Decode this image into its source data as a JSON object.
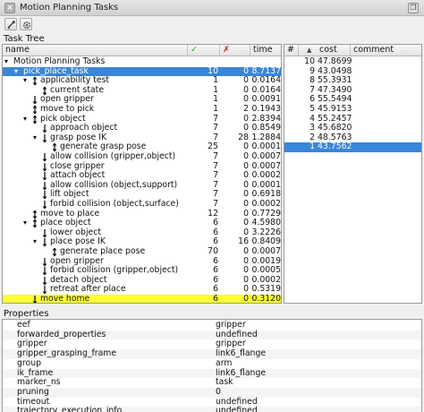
{
  "window": {
    "title": "Motion Planning Tasks",
    "close_glyph": "×",
    "float_glyph": "❐"
  },
  "toolbar": {
    "buttons": [
      "reset-icon",
      "settings-icon"
    ]
  },
  "task_tree": {
    "label": "Task Tree",
    "columns": {
      "name": "name",
      "ok": "✓",
      "fail": "✗",
      "time": "time"
    },
    "ok_color": "#2e9e2e",
    "fail_color": "#d42020",
    "rows": [
      {
        "name": "Motion Planning Tasks",
        "ok": "",
        "fail": "",
        "time": "",
        "icon": "",
        "expander": "▾",
        "level": 0
      },
      {
        "name": "pick_place_task",
        "ok": "10",
        "fail": "0",
        "time": "8.7137",
        "icon": "",
        "expander": "▾",
        "level": 1,
        "selected": true
      },
      {
        "name": "applicability test",
        "ok": "1",
        "fail": "0",
        "time": "0.0164",
        "icon": "both",
        "expander": "▾",
        "level": 2
      },
      {
        "name": "current state",
        "ok": "1",
        "fail": "0",
        "time": "0.0164",
        "icon": "both",
        "expander": "",
        "level": 3
      },
      {
        "name": "open gripper",
        "ok": "1",
        "fail": "0",
        "time": "0.0091",
        "icon": "down",
        "expander": "",
        "level": 2
      },
      {
        "name": "move to pick",
        "ok": "1",
        "fail": "2",
        "time": "0.1943",
        "icon": "both",
        "expander": "",
        "level": 2
      },
      {
        "name": "pick object",
        "ok": "7",
        "fail": "0",
        "time": "2.8394",
        "icon": "both",
        "expander": "▾",
        "level": 2
      },
      {
        "name": "approach object",
        "ok": "7",
        "fail": "0",
        "time": "0.8549",
        "icon": "down",
        "expander": "",
        "level": 3
      },
      {
        "name": "grasp pose IK",
        "ok": "7",
        "fail": "28",
        "time": "1.2884",
        "icon": "down",
        "expander": "▾",
        "level": 3
      },
      {
        "name": "generate grasp pose",
        "ok": "25",
        "fail": "0",
        "time": "0.0001",
        "icon": "both",
        "expander": "",
        "level": 4
      },
      {
        "name": "allow collision (gripper,object)",
        "ok": "7",
        "fail": "0",
        "time": "0.0007",
        "icon": "down",
        "expander": "",
        "level": 3
      },
      {
        "name": "close gripper",
        "ok": "7",
        "fail": "0",
        "time": "0.0007",
        "icon": "down",
        "expander": "",
        "level": 3
      },
      {
        "name": "attach object",
        "ok": "7",
        "fail": "0",
        "time": "0.0002",
        "icon": "down",
        "expander": "",
        "level": 3
      },
      {
        "name": "allow collision (object,support)",
        "ok": "7",
        "fail": "0",
        "time": "0.0001",
        "icon": "down",
        "expander": "",
        "level": 3
      },
      {
        "name": "lift object",
        "ok": "7",
        "fail": "0",
        "time": "0.6918",
        "icon": "down",
        "expander": "",
        "level": 3
      },
      {
        "name": "forbid collision (object,surface)",
        "ok": "7",
        "fail": "0",
        "time": "0.0002",
        "icon": "down",
        "expander": "",
        "level": 3
      },
      {
        "name": "move to place",
        "ok": "12",
        "fail": "0",
        "time": "0.7729",
        "icon": "both",
        "expander": "",
        "level": 2
      },
      {
        "name": "place object",
        "ok": "6",
        "fail": "0",
        "time": "4.5980",
        "icon": "both",
        "expander": "▾",
        "level": 2
      },
      {
        "name": "lower object",
        "ok": "6",
        "fail": "0",
        "time": "3.2226",
        "icon": "down",
        "expander": "",
        "level": 3
      },
      {
        "name": "place pose IK",
        "ok": "6",
        "fail": "16",
        "time": "0.8409",
        "icon": "down",
        "expander": "▾",
        "level": 3
      },
      {
        "name": "generate place pose",
        "ok": "70",
        "fail": "0",
        "time": "0.0007",
        "icon": "both",
        "expander": "",
        "level": 4
      },
      {
        "name": "open gripper",
        "ok": "6",
        "fail": "0",
        "time": "0.0019",
        "icon": "down",
        "expander": "",
        "level": 3
      },
      {
        "name": "forbid collision (gripper,object)",
        "ok": "6",
        "fail": "0",
        "time": "0.0005",
        "icon": "down",
        "expander": "",
        "level": 3
      },
      {
        "name": "detach object",
        "ok": "6",
        "fail": "0",
        "time": "0.0002",
        "icon": "down",
        "expander": "",
        "level": 3
      },
      {
        "name": "retreat after place",
        "ok": "6",
        "fail": "0",
        "time": "0.5319",
        "icon": "down",
        "expander": "",
        "level": 3
      },
      {
        "name": "move home",
        "ok": "6",
        "fail": "0",
        "time": "0.3120",
        "icon": "down",
        "expander": "",
        "level": 2,
        "highlight": true
      }
    ]
  },
  "solutions": {
    "columns": {
      "index": "#",
      "sort": "▲",
      "cost": "cost",
      "comment": "comment"
    },
    "rows": [
      {
        "index": "10",
        "cost": "47.8699"
      },
      {
        "index": "9",
        "cost": "43.0498"
      },
      {
        "index": "8",
        "cost": "55.3931"
      },
      {
        "index": "7",
        "cost": "47.3490"
      },
      {
        "index": "6",
        "cost": "55.5494"
      },
      {
        "index": "5",
        "cost": "45.9153"
      },
      {
        "index": "4",
        "cost": "55.2457"
      },
      {
        "index": "3",
        "cost": "45.6820"
      },
      {
        "index": "2",
        "cost": "48.5763"
      },
      {
        "index": "1",
        "cost": "43.7562",
        "selected": true
      }
    ]
  },
  "properties": {
    "label": "Properties",
    "rows": [
      {
        "key": "eef",
        "value": "gripper"
      },
      {
        "key": "forwarded_properties",
        "value": "undefined"
      },
      {
        "key": "gripper",
        "value": "gripper"
      },
      {
        "key": "gripper_grasping_frame",
        "value": "link6_flange"
      },
      {
        "key": "group",
        "value": "arm"
      },
      {
        "key": "ik_frame",
        "value": "link6_flange"
      },
      {
        "key": "marker_ns",
        "value": "task"
      },
      {
        "key": "pruning",
        "value": "0"
      },
      {
        "key": "timeout",
        "value": "undefined"
      },
      {
        "key": "trajectory_execution_info",
        "value": "undefined"
      }
    ]
  },
  "colors": {
    "selection": "#3a86d8",
    "highlight": "#ffff33",
    "selected_text": "#ffffff"
  }
}
